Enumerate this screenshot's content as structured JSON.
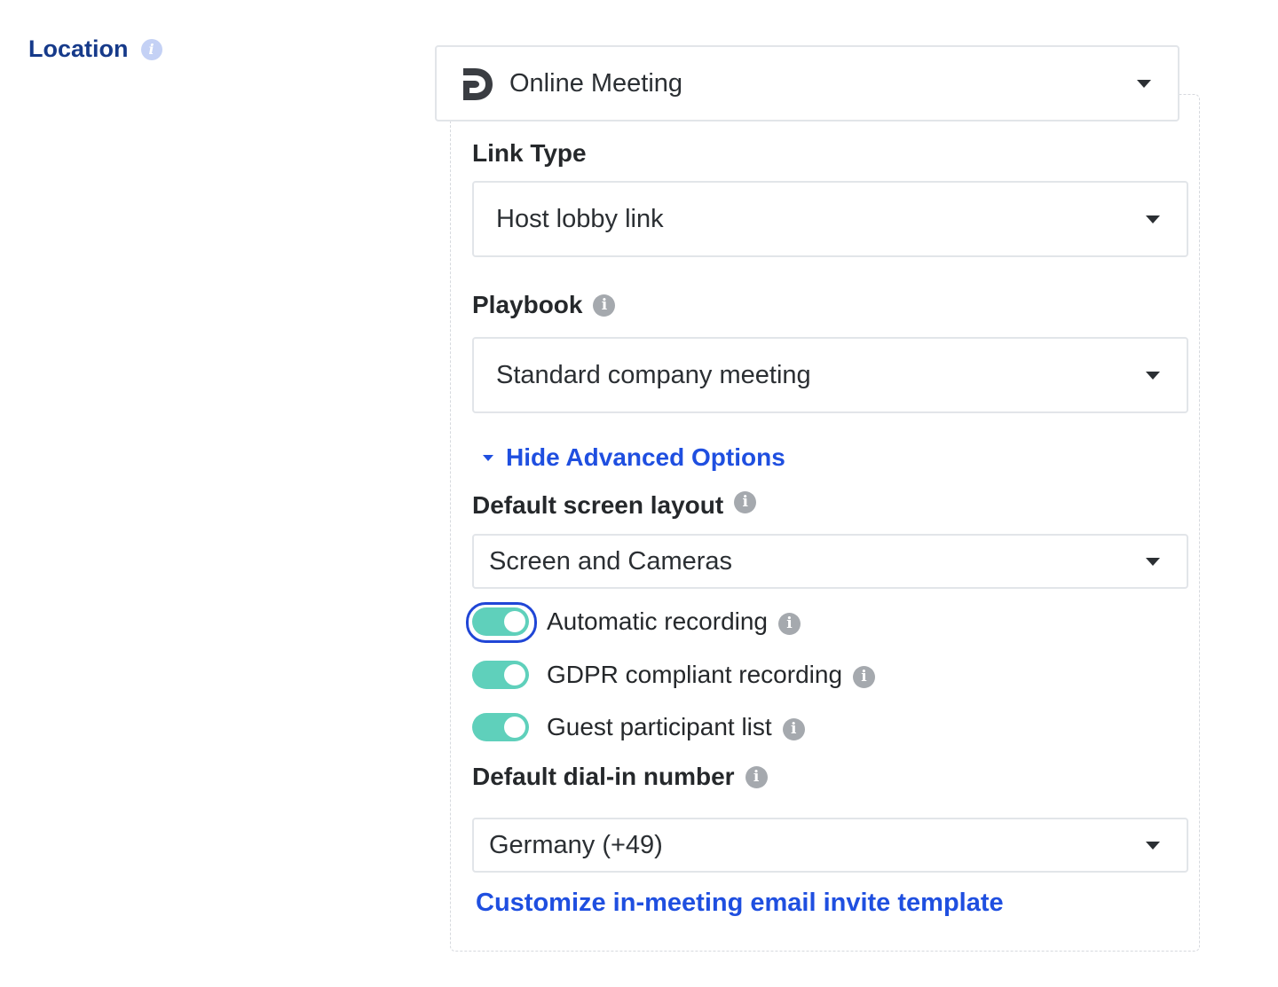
{
  "location": {
    "label": "Location",
    "info_icon": "info-icon",
    "selected": "Online Meeting",
    "brand_icon": "dialpad-logo-icon"
  },
  "link_type": {
    "label": "Link Type",
    "selected": "Host lobby link"
  },
  "playbook": {
    "label": "Playbook",
    "selected": "Standard company meeting"
  },
  "advanced_toggle": {
    "label": "Hide Advanced Options"
  },
  "screen_layout": {
    "label": "Default screen layout",
    "selected": "Screen and Cameras"
  },
  "toggles": [
    {
      "label": "Automatic recording",
      "on": true,
      "focused": true
    },
    {
      "label": "GDPR compliant recording",
      "on": true,
      "focused": false
    },
    {
      "label": "Guest participant list",
      "on": true,
      "focused": false
    }
  ],
  "dial_in": {
    "label": "Default dial-in number",
    "selected": "Germany (+49)"
  },
  "customize_link": "Customize in-meeting email invite template",
  "colors": {
    "accent_blue": "#1f4fe0",
    "location_label": "#163a8a",
    "toggle_on": "#5fd0bb",
    "focus_ring": "#2046d6"
  }
}
